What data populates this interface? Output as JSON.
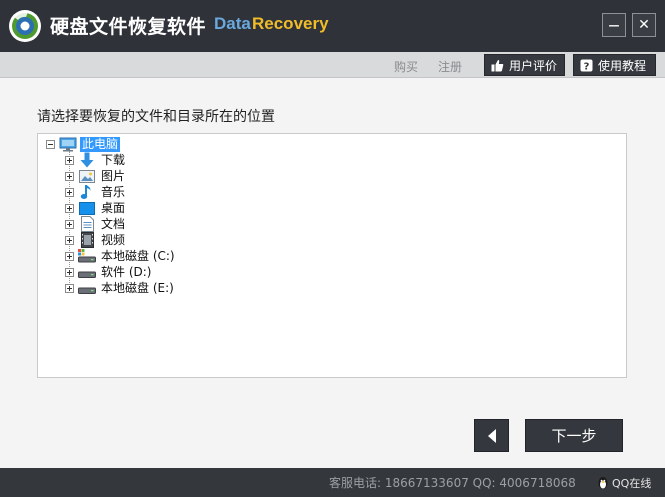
{
  "titlebar": {
    "title": "硬盘文件恢复软件",
    "brand_part1": "Data",
    "brand_part2": "Recovery",
    "minimize_label": "—",
    "close_label": "✕"
  },
  "toolbar": {
    "buy_label": "购买",
    "register_label": "注册",
    "review_label": "用户评价",
    "tutorial_label": "使用教程"
  },
  "main": {
    "prompt": "请选择要恢复的文件和目录所在的位置"
  },
  "tree": {
    "root": {
      "label": "此电脑",
      "icon": "computer-icon",
      "expanded": true,
      "selected": true
    },
    "items": [
      {
        "label": "下载",
        "icon": "download-icon"
      },
      {
        "label": "图片",
        "icon": "pictures-icon"
      },
      {
        "label": "音乐",
        "icon": "music-icon"
      },
      {
        "label": "桌面",
        "icon": "desktop-icon"
      },
      {
        "label": "文档",
        "icon": "documents-icon"
      },
      {
        "label": "视频",
        "icon": "videos-icon"
      },
      {
        "label": "本地磁盘 (C:)",
        "icon": "system-drive-icon"
      },
      {
        "label": "软件 (D:)",
        "icon": "drive-icon"
      },
      {
        "label": "本地磁盘 (E:)",
        "icon": "drive-icon"
      }
    ]
  },
  "nav": {
    "back_icon": "back-arrow-icon",
    "next_label": "下一步"
  },
  "statusbar": {
    "contact_text": "客服电话: 18667133607 QQ: 4006718068",
    "qq_label": "QQ在线"
  },
  "colors": {
    "titlebar_bg": "#2f3238",
    "brand_data": "#6aa8de",
    "brand_recovery": "#f0bd2a",
    "selection": "#3399ff",
    "button_bg": "#34373d"
  }
}
